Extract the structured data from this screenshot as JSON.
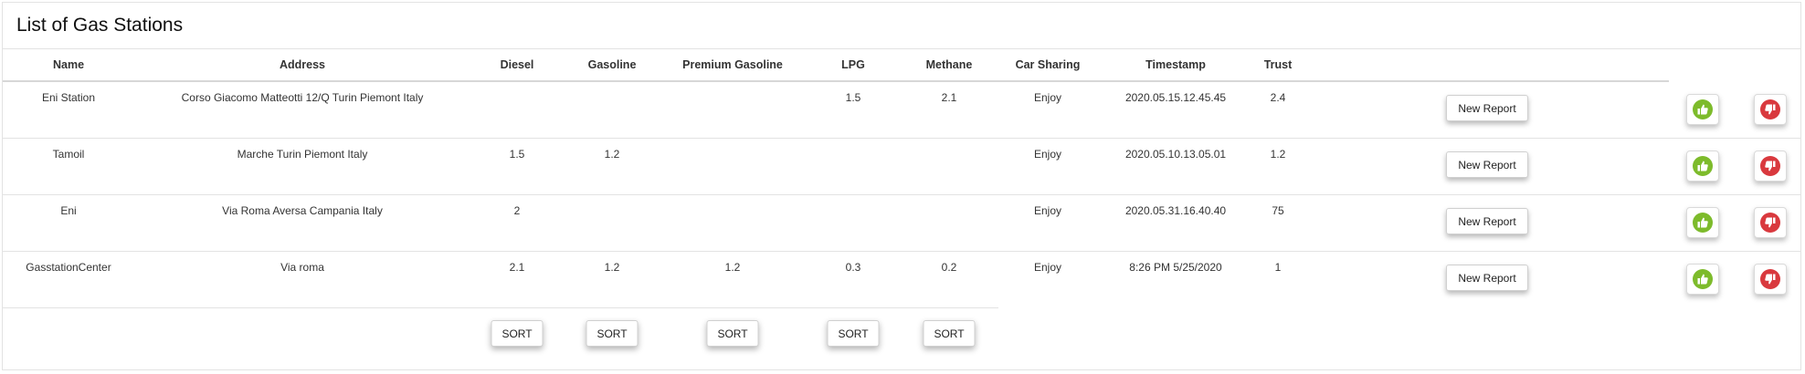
{
  "page": {
    "title": "List of Gas Stations"
  },
  "table": {
    "headers": {
      "name": "Name",
      "address": "Address",
      "diesel": "Diesel",
      "gasoline": "Gasoline",
      "premium_gasoline": "Premium Gasoline",
      "lpg": "LPG",
      "methane": "Methane",
      "car_sharing": "Car Sharing",
      "timestamp": "Timestamp",
      "trust": "Trust"
    },
    "rows": [
      {
        "name": "Eni Station",
        "address": "Corso Giacomo Matteotti 12/Q Turin Piemont Italy",
        "diesel": "",
        "gasoline": "",
        "premium_gasoline": "",
        "lpg": "1.5",
        "methane": "2.1",
        "car_sharing": "Enjoy",
        "timestamp": "2020.05.15.12.45.45",
        "trust": "2.4",
        "report_label": "New Report"
      },
      {
        "name": "Tamoil",
        "address": "Marche Turin Piemont Italy",
        "diesel": "1.5",
        "gasoline": "1.2",
        "premium_gasoline": "",
        "lpg": "",
        "methane": "",
        "car_sharing": "Enjoy",
        "timestamp": "2020.05.10.13.05.01",
        "trust": "1.2",
        "report_label": "New Report"
      },
      {
        "name": "Eni",
        "address": "Via Roma Aversa Campania Italy",
        "diesel": "2",
        "gasoline": "",
        "premium_gasoline": "",
        "lpg": "",
        "methane": "",
        "car_sharing": "Enjoy",
        "timestamp": "2020.05.31.16.40.40",
        "trust": "75",
        "report_label": "New Report"
      },
      {
        "name": "GasstationCenter",
        "address": "Via roma",
        "diesel": "2.1",
        "gasoline": "1.2",
        "premium_gasoline": "1.2",
        "lpg": "0.3",
        "methane": "0.2",
        "car_sharing": "Enjoy",
        "timestamp": "8:26 PM 5/25/2020",
        "trust": "1",
        "report_label": "New Report"
      }
    ],
    "sort_label": "SORT"
  },
  "icons": {
    "thumbs_up": "thumbs-up-icon",
    "thumbs_down": "thumbs-down-icon"
  },
  "colors": {
    "like": "#7dbb2b",
    "dislike": "#d9393e"
  }
}
